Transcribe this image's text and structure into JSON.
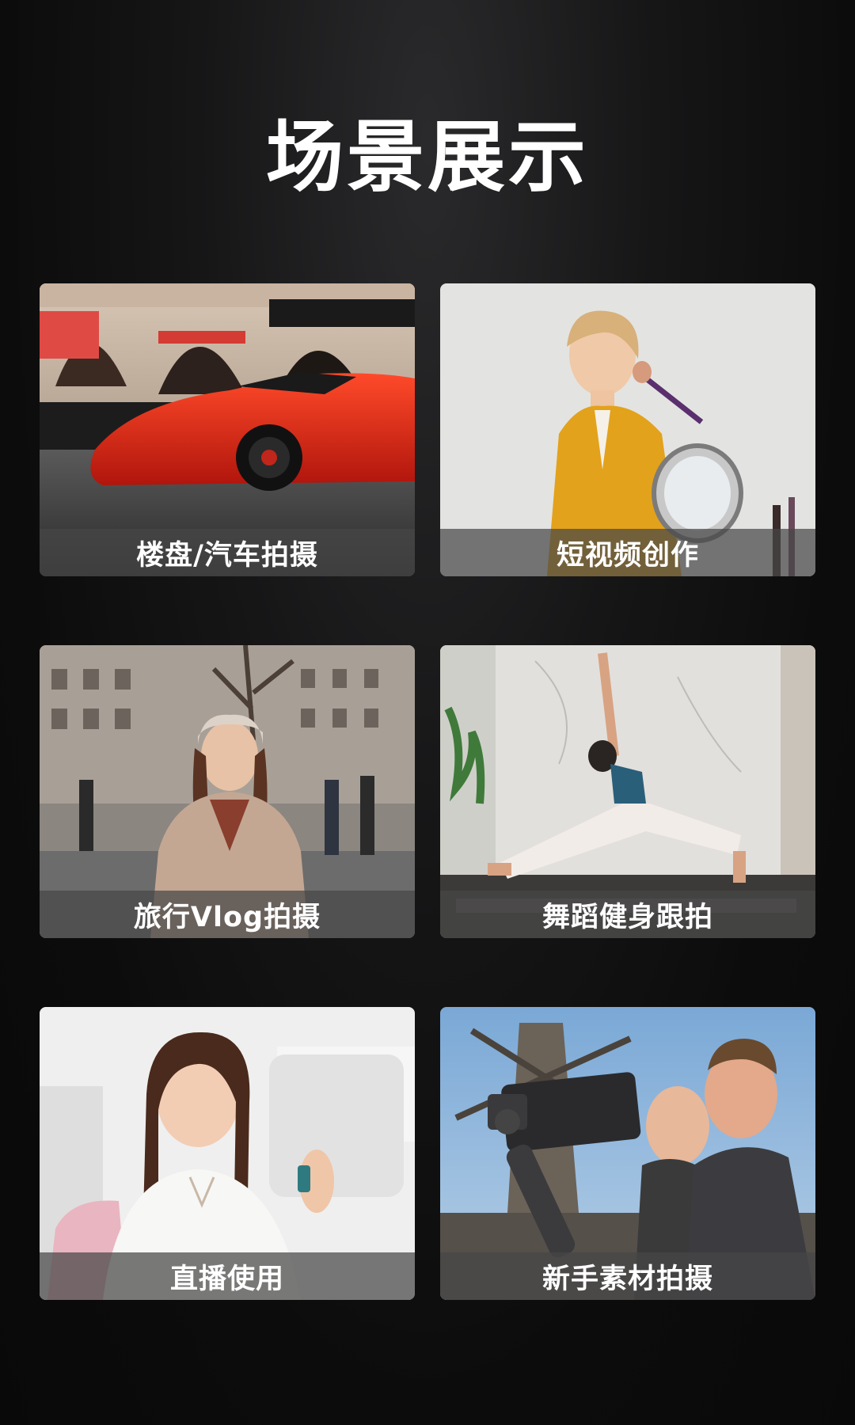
{
  "title": "场景展示",
  "colors": {
    "background": "#0f0f10",
    "title": "#ffffff",
    "caption_bar": "rgba(70,70,70,0.72)"
  },
  "scenes": [
    {
      "caption": "楼盘/汽车拍摄",
      "icon": "sports-car-photo"
    },
    {
      "caption": "短视频创作",
      "icon": "makeup-woman-photo"
    },
    {
      "caption": "旅行Vlog拍摄",
      "icon": "travel-woman-photo"
    },
    {
      "caption": "舞蹈健身跟拍",
      "icon": "yoga-woman-photo"
    },
    {
      "caption": "直播使用",
      "icon": "livestream-woman-photo"
    },
    {
      "caption": "新手素材拍摄",
      "icon": "gimbal-selfie-photo"
    }
  ]
}
